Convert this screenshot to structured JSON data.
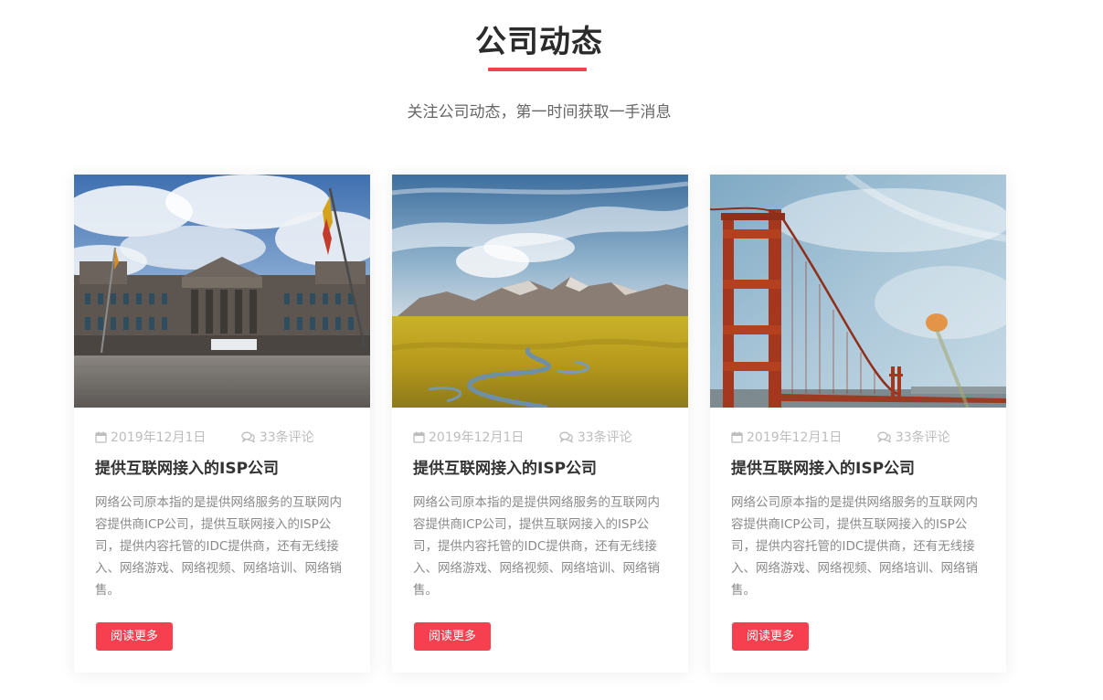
{
  "section": {
    "title": "公司动态",
    "subtitle": "关注公司动态，第一时间获取一手消息",
    "accent_color": "#f0434e"
  },
  "cards": [
    {
      "image": "reichstag-building-photo",
      "date": "2019年12月1日",
      "comments": "33条评论",
      "title": "提供互联网接入的ISP公司",
      "desc": "网络公司原本指的是提供网络服务的互联网内容提供商ICP公司，提供互联网接入的ISP公司，提供内容托管的IDC提供商，还有无线接入、网络游戏、网络视频、网络培训、网络销售。",
      "button": "阅读更多"
    },
    {
      "image": "mountain-valley-photo",
      "date": "2019年12月1日",
      "comments": "33条评论",
      "title": "提供互联网接入的ISP公司",
      "desc": "网络公司原本指的是提供网络服务的互联网内容提供商ICP公司，提供互联网接入的ISP公司，提供内容托管的IDC提供商，还有无线接入、网络游戏、网络视频、网络培训、网络销售。",
      "button": "阅读更多"
    },
    {
      "image": "golden-gate-bridge-photo",
      "date": "2019年12月1日",
      "comments": "33条评论",
      "title": "提供互联网接入的ISP公司",
      "desc": "网络公司原本指的是提供网络服务的互联网内容提供商ICP公司，提供互联网接入的ISP公司，提供内容托管的IDC提供商，还有无线接入、网络游戏、网络视频、网络培训、网络销售。",
      "button": "阅读更多"
    }
  ],
  "icons": {
    "date": "calendar-icon",
    "comments": "comments-icon"
  },
  "colors": {
    "button": "#f6404f",
    "title_text": "#333333",
    "meta_text": "#bdbdbd",
    "desc_text": "#8a8a8a"
  }
}
